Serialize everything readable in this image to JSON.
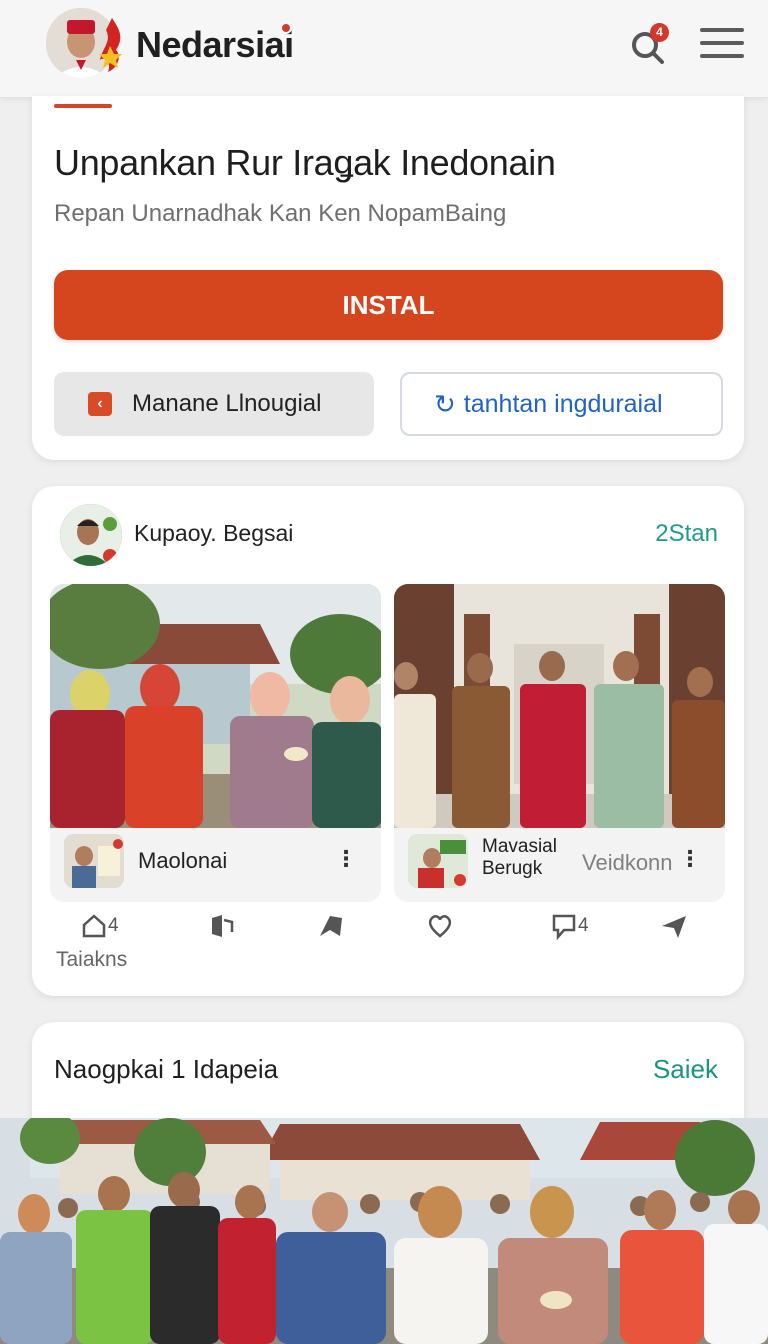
{
  "header": {
    "app_title": "Nedarsiai",
    "notification_count": "4"
  },
  "hero": {
    "title": "Unpankan Rur Iraǥak Inedonain",
    "subtitle": "Repan Unarnadhak Kan Ken NopamBaing",
    "install_label": "INSTAL",
    "secondary_left_label": "Manane Llnougial",
    "secondary_right_label": "tanhtan ingduraial"
  },
  "feed": {
    "author": "Kupaoy. Begsai",
    "time": "2Stan",
    "posts": [
      {
        "name": "Maolonai",
        "meta": ""
      },
      {
        "name": "Mavasial Berugk",
        "meta": "Veidkonn"
      }
    ],
    "actions": {
      "home_count": "4",
      "comment_count": "4"
    },
    "footer_label": "Taiakns"
  },
  "section": {
    "title": "Naogpkai 1 Idapeia",
    "link": "Saiek"
  },
  "colors": {
    "accent": "#d5461f",
    "link_teal": "#219a8a",
    "link_blue": "#1f63c7"
  }
}
